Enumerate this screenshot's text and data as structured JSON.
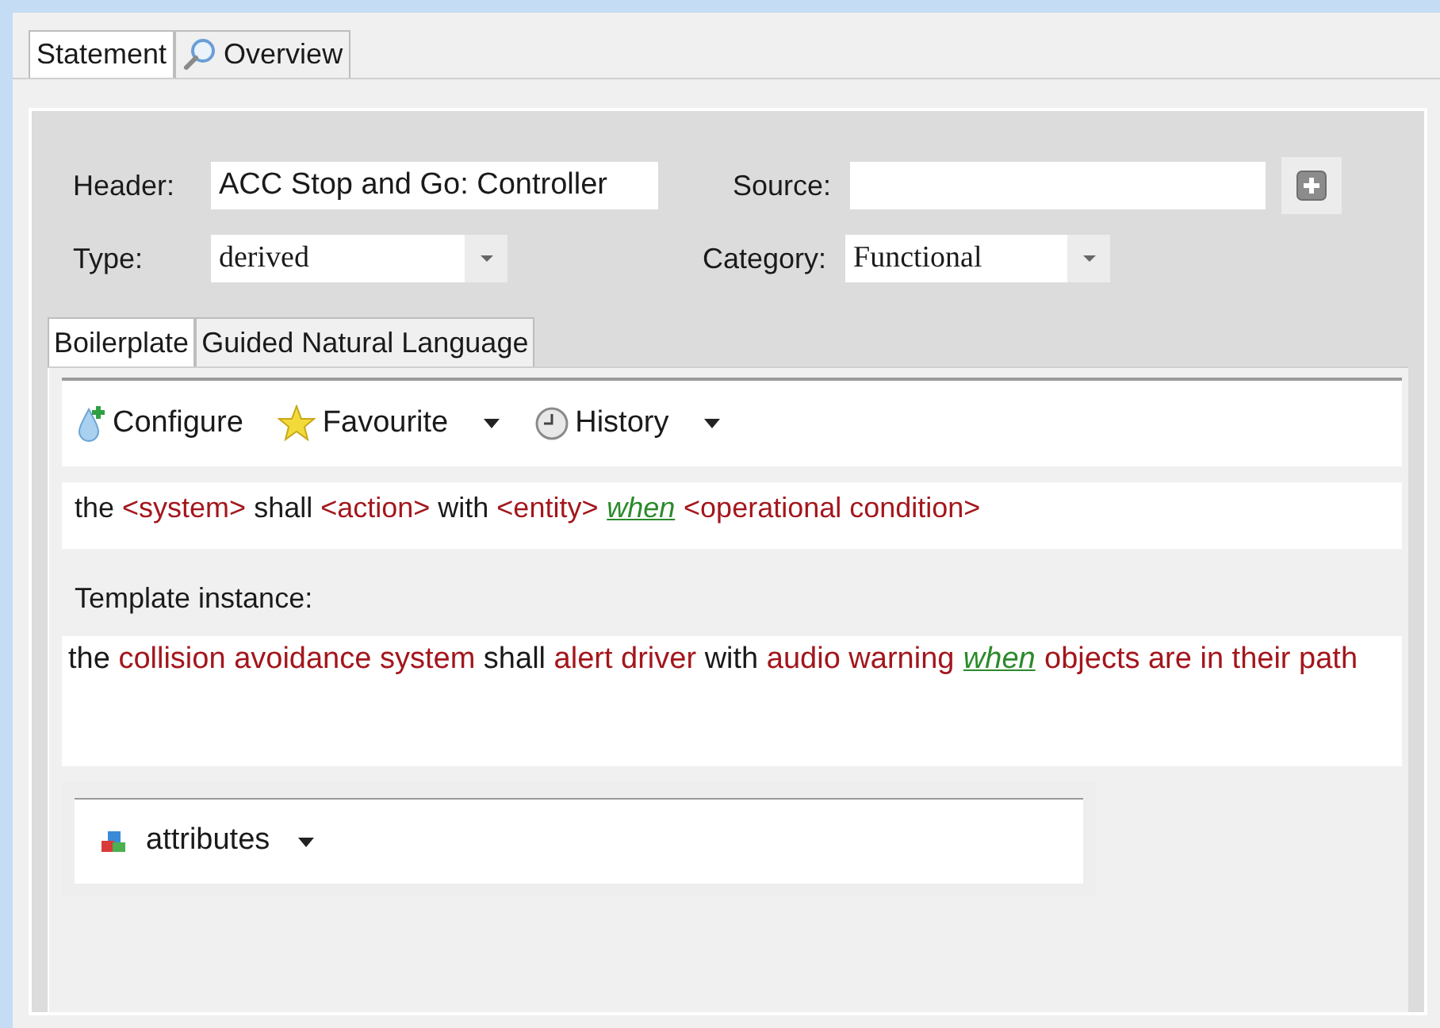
{
  "tabs": [
    {
      "label": "Statement",
      "selected": true
    },
    {
      "label": "Overview",
      "selected": false
    }
  ],
  "form": {
    "header": {
      "label": "Header:",
      "value": "ACC Stop and Go: Controller"
    },
    "source": {
      "label": "Source:"
    },
    "type": {
      "label": "Type:",
      "value": "derived"
    },
    "category": {
      "label": "Category:",
      "value": "Functional"
    }
  },
  "inner_tabs": [
    {
      "label": "Boilerplate",
      "selected": true
    },
    {
      "label": "Guided Natural Language",
      "selected": false
    }
  ],
  "toolbar": [
    {
      "label": "Configure",
      "kind": "configure",
      "dropdown": false
    },
    {
      "label": "Favourite",
      "kind": "favourite",
      "dropdown": true
    },
    {
      "label": "History",
      "kind": "history",
      "dropdown": true
    }
  ],
  "boilerplate": [
    {
      "text": "the ",
      "kind": "plain"
    },
    {
      "text": "<system>",
      "kind": "slot"
    },
    {
      "text": " shall ",
      "kind": "plain"
    },
    {
      "text": "<action>",
      "kind": "slot"
    },
    {
      "text": " with ",
      "kind": "plain"
    },
    {
      "text": "<entity>",
      "kind": "slot"
    },
    {
      "text": "when",
      "kind": "keyword"
    },
    {
      "text": "<operational condition>",
      "kind": "slot"
    }
  ],
  "template_instance": {
    "label": "Template instance:",
    "segments": [
      {
        "text": "the ",
        "kind": "plain"
      },
      {
        "text": "collision avoidance system",
        "kind": "slot"
      },
      {
        "text": " shall ",
        "kind": "plain"
      },
      {
        "text": "alert driver",
        "kind": "slot"
      },
      {
        "text": " with ",
        "kind": "plain"
      },
      {
        "text": "audio warning",
        "kind": "slot"
      },
      {
        "text": "when",
        "kind": "keyword"
      },
      {
        "text": "objects are in their path",
        "kind": "slot"
      }
    ]
  },
  "attributes": {
    "label": "attributes",
    "dropdown": true
  }
}
